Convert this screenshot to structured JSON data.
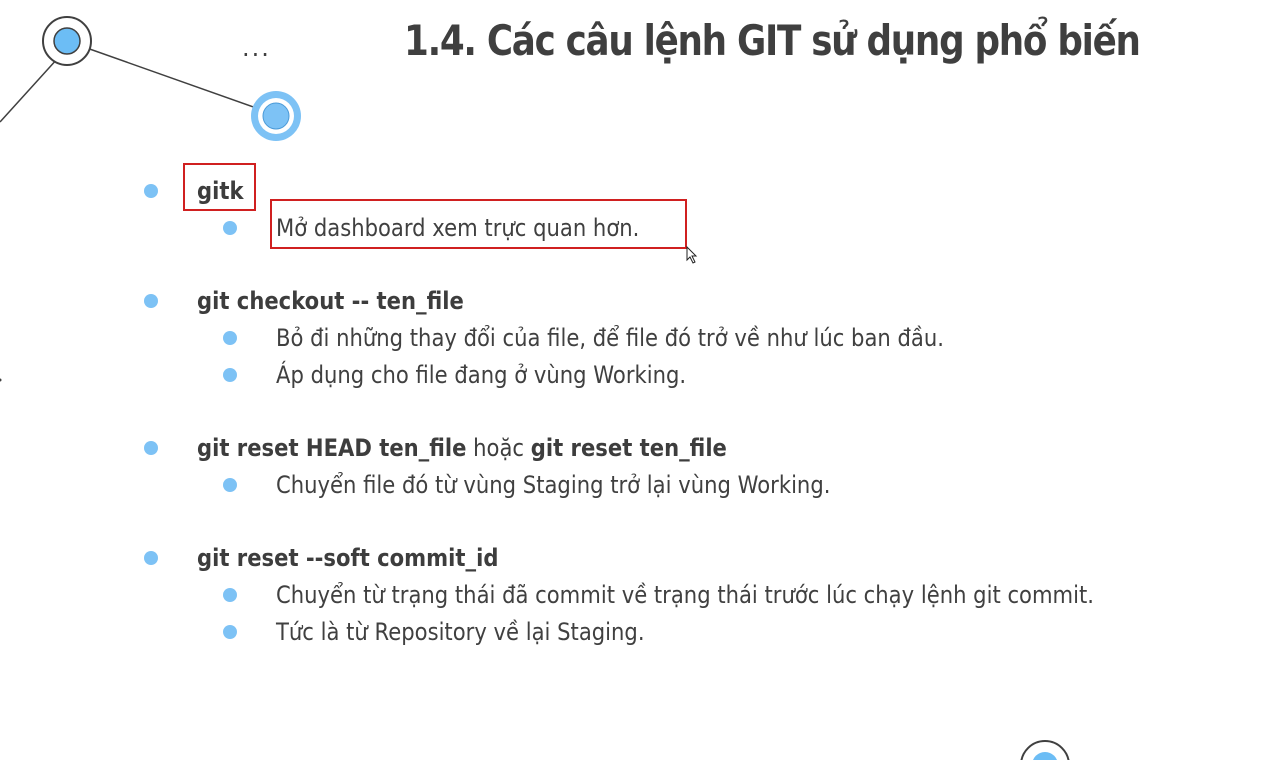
{
  "title": "1.4. Các câu lệnh GIT sử dụng phổ biến",
  "ellipsis": "...",
  "items": [
    {
      "command": "gitk",
      "details": [
        "Mở dashboard xem trực quan hơn."
      ]
    },
    {
      "command": "git checkout -- ten_file",
      "details": [
        "Bỏ đi những thay đổi của file, để file đó trở về như lúc ban đầu.",
        "Áp dụng cho file đang ở vùng Working."
      ]
    },
    {
      "command": "git reset HEAD ten_file",
      "connector": " hoặc ",
      "command_alt": "git reset ten_file",
      "details": [
        "Chuyển file đó từ vùng Staging trở lại vùng Working."
      ]
    },
    {
      "command": "git reset --soft commit_id",
      "details": [
        "Chuyển từ trạng thái đã commit về trạng thái trước lúc chạy lệnh git commit.",
        "Tức là từ Repository về lại Staging."
      ]
    }
  ],
  "colors": {
    "bullet": "#7dc2f5",
    "highlight_border": "#d02020",
    "text": "#404040"
  }
}
